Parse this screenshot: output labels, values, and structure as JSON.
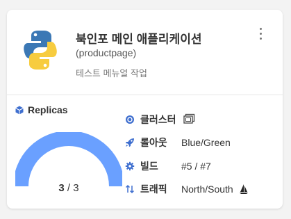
{
  "app": {
    "name": "북인포 메인 애플리케이션",
    "id_label": "(productpage)",
    "description": "테스트 메뉴얼 작업"
  },
  "replicas": {
    "label": "Replicas",
    "current": 3,
    "separator": "/",
    "total": 3,
    "fill_fraction": 1.0
  },
  "info": {
    "cluster": {
      "label": "클러스터"
    },
    "rollout": {
      "label": "롤아웃",
      "value": "Blue/Green"
    },
    "build": {
      "label": "빌드",
      "value": "#5 / #7"
    },
    "traffic": {
      "label": "트래픽",
      "value": "North/South"
    }
  },
  "colors": {
    "accent": "#6aa0ff",
    "icon_blue": "#3f6fcf",
    "python_blue": "#3b78b5",
    "python_yellow": "#f7cc3f"
  }
}
